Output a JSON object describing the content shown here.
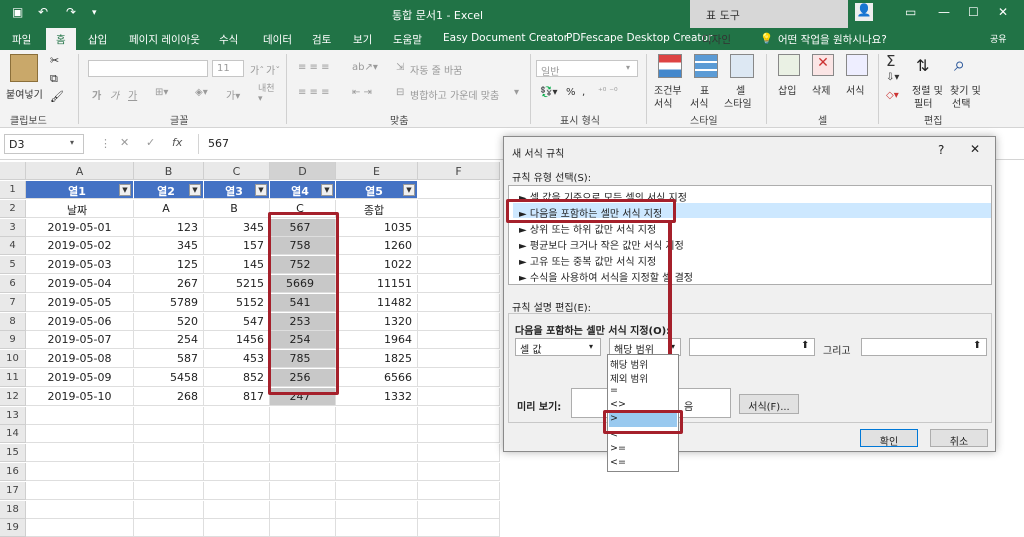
{
  "window": {
    "title": "통합 문서1 - Excel",
    "tool_tab": "표 도구",
    "sign_in": "공유"
  },
  "ribbon_tabs": [
    "파일",
    "홈",
    "삽입",
    "페이지 레이아웃",
    "수식",
    "데이터",
    "검토",
    "보기",
    "도움말",
    "Easy Document Creator",
    "PDFescape Desktop Creator",
    "디자인"
  ],
  "tell_me": "어떤 작업을 원하시나요?",
  "ribbon": {
    "paste_label": "붙여넣기",
    "clipboard_label": "클립보드",
    "font_group": "글꼴",
    "font_size": "11",
    "bold": "가",
    "italic": "가",
    "underline": "가",
    "align_group": "맞춤",
    "wrap_text": "자동 줄 바꿈",
    "merge_center": "병합하고 가운데 맞춤",
    "number_format": "일반",
    "number_group": "표시 형식",
    "percent": "%",
    "comma": ",",
    "cond_format": "조건부",
    "cond_format2": "서식",
    "table_format": "표",
    "table_format2": "서식",
    "cell_style": "셀",
    "cell_style2": "스타일",
    "style_group": "스타일",
    "insert": "삽입",
    "delete": "삭제",
    "format": "서식",
    "cells_group": "셀",
    "sort_filter": "정렬 및",
    "sort_filter2": "필터",
    "find_select": "찾기 및",
    "find_select2": "선택",
    "editing_group": "편집",
    "sum": "Σ"
  },
  "formula_bar": {
    "name_box": "D3",
    "fx": "fx",
    "value": "567"
  },
  "sheet": {
    "columns": [
      "A",
      "B",
      "C",
      "D",
      "E",
      "F"
    ],
    "rows": [
      "1",
      "2",
      "3",
      "4",
      "5",
      "6",
      "7",
      "8",
      "9",
      "10",
      "11",
      "12",
      "13",
      "14",
      "15",
      "16",
      "17",
      "18",
      "19"
    ],
    "headers": [
      "열1",
      "열2",
      "열3",
      "열4",
      "열5"
    ],
    "row2": [
      "날짜",
      "A",
      "B",
      "C",
      "종합"
    ],
    "data": [
      [
        "2019-05-01",
        "123",
        "345",
        "567",
        "1035"
      ],
      [
        "2019-05-02",
        "345",
        "157",
        "758",
        "1260"
      ],
      [
        "2019-05-03",
        "125",
        "145",
        "752",
        "1022"
      ],
      [
        "2019-05-04",
        "267",
        "5215",
        "5669",
        "11151"
      ],
      [
        "2019-05-05",
        "5789",
        "5152",
        "541",
        "11482"
      ],
      [
        "2019-05-06",
        "520",
        "547",
        "253",
        "1320"
      ],
      [
        "2019-05-07",
        "254",
        "1456",
        "254",
        "1964"
      ],
      [
        "2019-05-08",
        "587",
        "453",
        "785",
        "1825"
      ],
      [
        "2019-05-09",
        "5458",
        "852",
        "256",
        "6566"
      ],
      [
        "2019-05-10",
        "268",
        "817",
        "247",
        "1332"
      ]
    ]
  },
  "dialog": {
    "title": "새 서식 규칙",
    "help": "?",
    "close": "✕",
    "rule_type_label": "규칙 유형 선택(S):",
    "rule_types": [
      "► 셀 값을 기준으로 모든 셀의 서식 지정",
      "► 다음을 포함하는 셀만 서식 지정",
      "► 상위 또는 하위 값만 서식 지정",
      "► 평균보다 크거나 작은 값만 서식 지정",
      "► 고유 또는 중복 값만 서식 지정",
      "► 수식을 사용하여 서식을 지정할 셀 결정"
    ],
    "edit_label": "규칙 설명 편집(E):",
    "edit_subtitle": "다음을 포함하는 셀만 서식 지정(O):",
    "cond1": "셀 값",
    "cond2": "해당 범위",
    "and_label": "그리고",
    "preview_label": "미리 보기:",
    "preview_text_left": "설",
    "preview_text_right": "음",
    "format_button": "서식(F)...",
    "ok": "확인",
    "cancel": "취소",
    "dropdown_options": [
      "해당 범위",
      "제외 범위",
      "=",
      "<>",
      ">",
      "<",
      ">=",
      "<="
    ],
    "selected_option": ">"
  },
  "colors": {
    "excel_green": "#217346",
    "table_header": "#4472c4",
    "highlight": "#a5202b",
    "selection": "#c8c8c8"
  }
}
